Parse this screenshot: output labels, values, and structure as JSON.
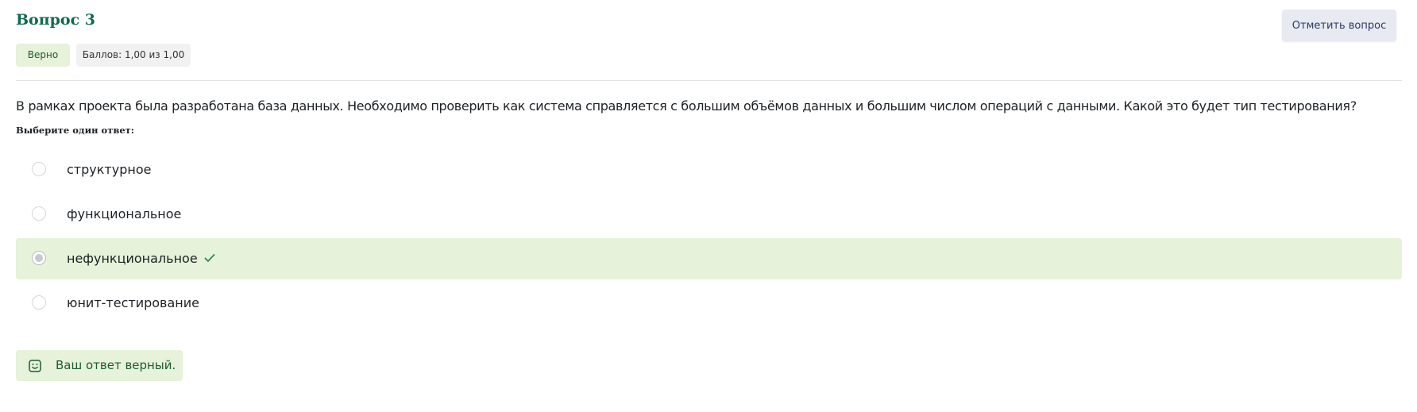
{
  "question": {
    "title": "Вопрос 3",
    "status_badge": "Верно",
    "grade_badge": "Баллов: 1,00 из 1,00",
    "flag_button": "Отметить вопрос",
    "text": "В рамках проекта была разработана база данных. Необходимо проверить как система справляется с большим объёмов данных и большим числом операций с данными. Какой это будет тип тестирования?",
    "prompt": "Выберите один ответ:"
  },
  "answers": [
    {
      "label": "структурное",
      "selected": false,
      "correct": false
    },
    {
      "label": "функциональное",
      "selected": false,
      "correct": false
    },
    {
      "label": "нефункциональное",
      "selected": true,
      "correct": true
    },
    {
      "label": "юнит-тестирование",
      "selected": false,
      "correct": false
    }
  ],
  "feedback": {
    "text": "Ваш ответ верный.",
    "icon": "smile-icon"
  },
  "colors": {
    "title": "#0f6b4f",
    "correct_bg": "#e6f2d9",
    "correct_text": "#1e5a36",
    "check": "#2e8b57",
    "flag_bg": "#e7eaf1"
  }
}
